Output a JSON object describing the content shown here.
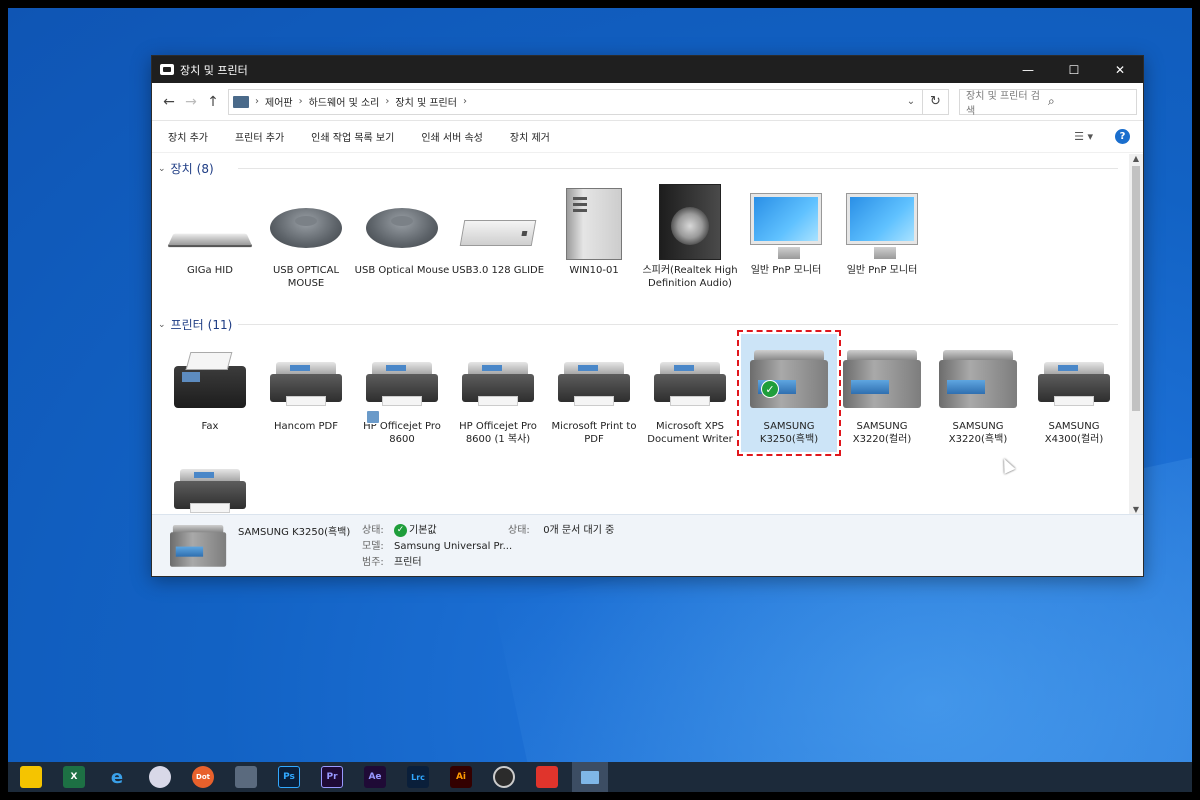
{
  "window": {
    "title": "장치 및 프린터",
    "controls": {
      "minimize": "—",
      "maximize": "☐",
      "close": "✕"
    }
  },
  "address": {
    "back": "←",
    "forward": "→",
    "up": "↑",
    "breadcrumbs": [
      "제어판",
      "하드웨어 및 소리",
      "장치 및 프린터"
    ],
    "separator": "›",
    "dropdown": "⌄",
    "refresh": "↻",
    "search_placeholder": "장치 및 프린터 검색",
    "search_icon": "⌕"
  },
  "commands": [
    "장치 추가",
    "프린터 추가",
    "인쇄 작업 목록 보기",
    "인쇄 서버 속성",
    "장치 제거"
  ],
  "view_icon": "☰ ▾",
  "help_icon": "?",
  "groups": {
    "devices": {
      "label": "장치",
      "count": "(8)",
      "chevron": "⌄"
    },
    "printers": {
      "label": "프린터",
      "count": "(11)",
      "chevron": "⌄"
    }
  },
  "devices": [
    {
      "name": "GIGa HID",
      "icon": "keyboard-icon"
    },
    {
      "name": "USB OPTICAL MOUSE",
      "icon": "mouse-icon"
    },
    {
      "name": "USB Optical Mouse",
      "icon": "mouse-icon"
    },
    {
      "name": "USB3.0 128 GLIDE",
      "icon": "hard-drive-icon"
    },
    {
      "name": "WIN10-01",
      "icon": "computer-tower-icon"
    },
    {
      "name": "스피커(Realtek High Definition Audio)",
      "icon": "speaker-icon"
    },
    {
      "name": "일반 PnP 모니터",
      "icon": "monitor-icon"
    },
    {
      "name": "일반 PnP 모니터",
      "icon": "monitor-icon"
    }
  ],
  "printers": [
    {
      "name": "Fax",
      "icon": "fax-icon"
    },
    {
      "name": "Hancom PDF",
      "icon": "printer-icon"
    },
    {
      "name": "HP Officejet Pro 8600",
      "icon": "printer-icon"
    },
    {
      "name": "HP Officejet Pro 8600 (1 복사)",
      "icon": "printer-icon"
    },
    {
      "name": "Microsoft Print to PDF",
      "icon": "printer-icon"
    },
    {
      "name": "Microsoft XPS Document Writer",
      "icon": "printer-icon"
    },
    {
      "name": "SAMSUNG K3250(흑백)",
      "icon": "multifunction-printer-icon",
      "selected": true,
      "default": true
    },
    {
      "name": "SAMSUNG X3220(컬러)",
      "icon": "multifunction-printer-icon"
    },
    {
      "name": "SAMSUNG X3220(흑백)",
      "icon": "multifunction-printer-icon"
    },
    {
      "name": "SAMSUNG X4300(컬러)",
      "icon": "printer-icon"
    }
  ],
  "default_check": "✓",
  "details": {
    "name": "SAMSUNG K3250(흑백)",
    "status_label": "상태:",
    "status_value": "기본값",
    "model_label": "모델:",
    "model_value": "Samsung Universal Pr...",
    "category_label": "범주:",
    "category_value": "프린터",
    "queue_label": "상태:",
    "queue_value": "0개 문서 대기 중"
  },
  "taskbar": [
    "sticky-notes-icon",
    "excel-icon",
    "edge-icon",
    "paint-icon",
    "dot-app-icon",
    "calculator-icon",
    "photoshop-icon",
    "premiere-icon",
    "after-effects-icon",
    "lightroom-classic-icon",
    "illustrator-icon",
    "obs-icon",
    "anydesk-icon",
    "control-panel-icon"
  ],
  "taskbar_labels": {
    "ps": "Ps",
    "pr": "Pr",
    "ae": "Ae",
    "lrc": "Lrc",
    "ai": "Ai",
    "dot": "Dot",
    "e": "e",
    "x": "X"
  },
  "colors": {
    "accent": "#1a6ecd",
    "selection": "#cce4f7",
    "highlight_border": "#e0161c",
    "ok": "#1f9e3b"
  }
}
